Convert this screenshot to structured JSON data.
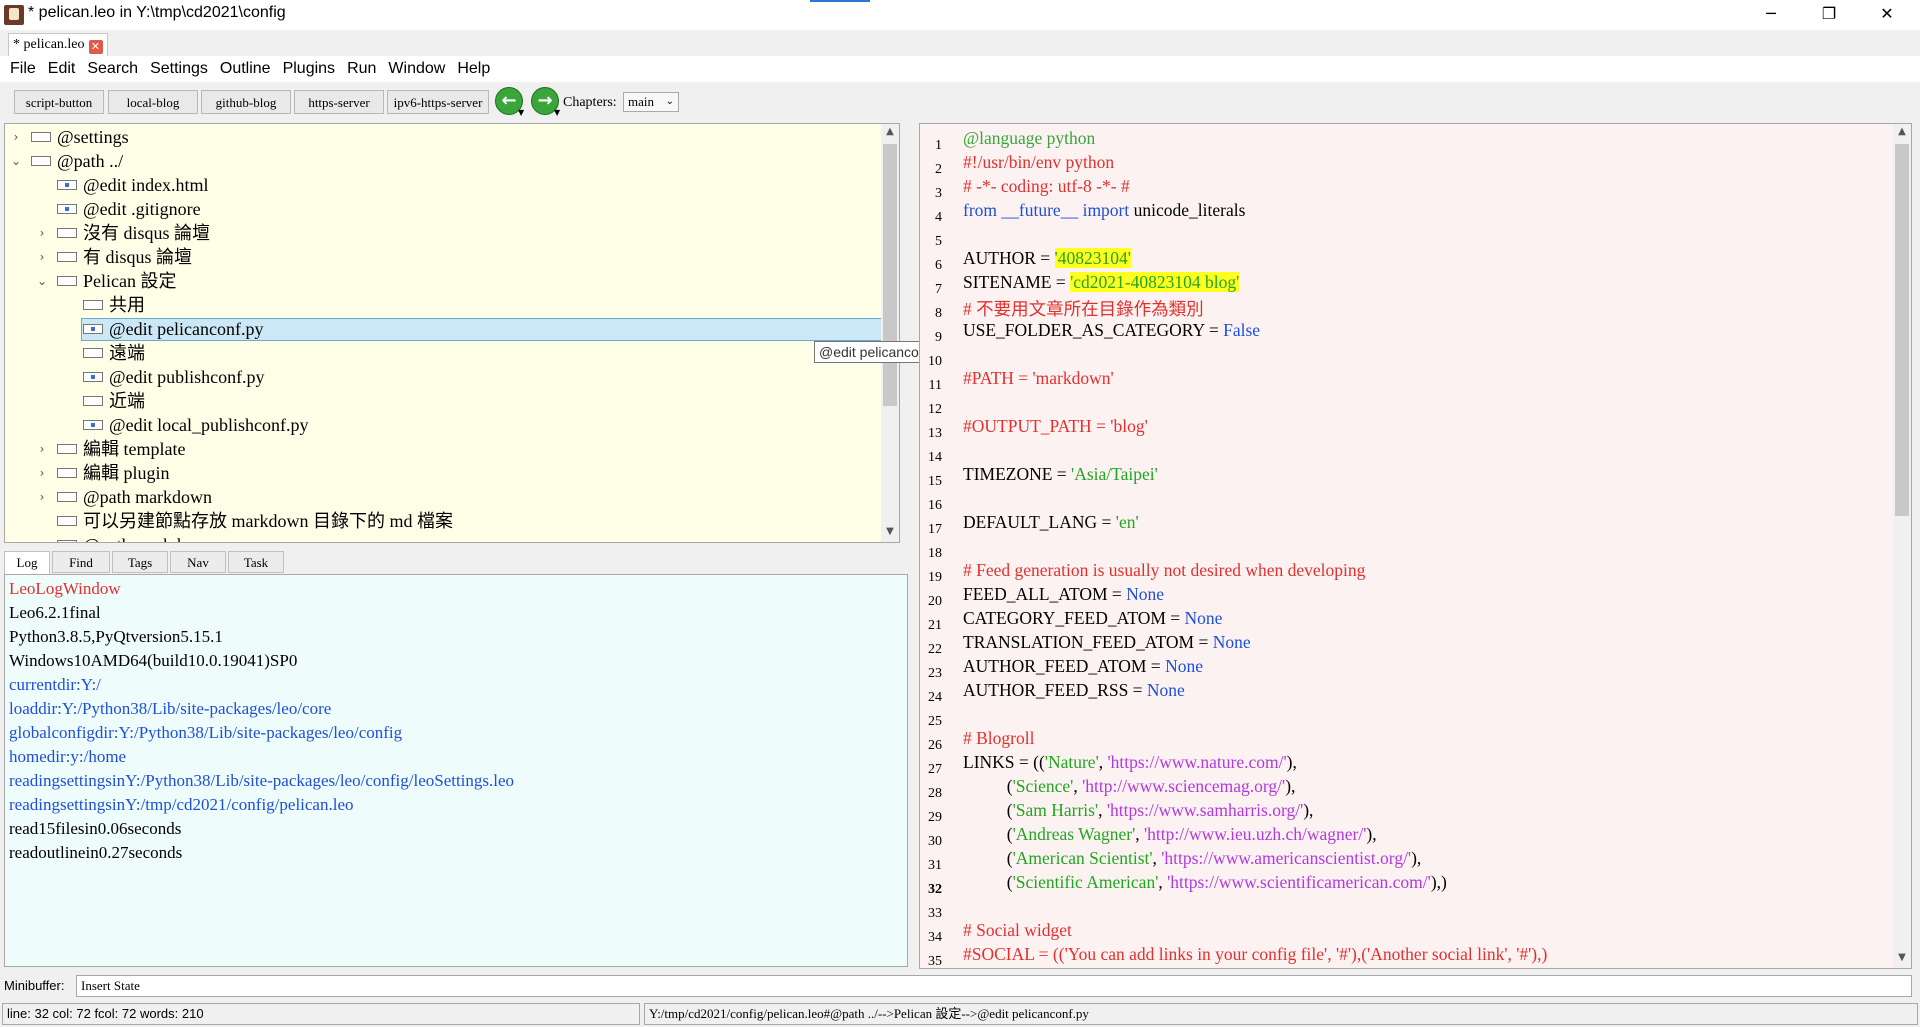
{
  "window": {
    "title": "* pelican.leo in Y:\\tmp\\cd2021\\config",
    "minimize": "─",
    "restore": "❐",
    "close": "✕"
  },
  "doc_tab": {
    "label": "* pelican.leo",
    "close": "✕"
  },
  "menu": [
    "File",
    "Edit",
    "Search",
    "Settings",
    "Outline",
    "Plugins",
    "Run",
    "Window",
    "Help"
  ],
  "toolbar": {
    "buttons": [
      "script-button",
      "local-blog",
      "github-blog",
      "https-server",
      "ipv6-https-server"
    ],
    "back_arrow": "←",
    "forward_arrow": "→",
    "chapters_label": "Chapters:",
    "chapters_value": "main"
  },
  "outline": {
    "nodes": [
      {
        "label": "@settings",
        "caret": "›"
      },
      {
        "label": "@path ../",
        "caret": "⌄"
      },
      {
        "label": "@edit index.html",
        "caret": ""
      },
      {
        "label": "@edit .gitignore",
        "caret": ""
      },
      {
        "label": "沒有 disqus 論壇",
        "caret": "›"
      },
      {
        "label": "有 disqus 論壇",
        "caret": "›"
      },
      {
        "label": "Pelican 設定",
        "caret": "⌄"
      },
      {
        "label": "共用",
        "caret": ""
      },
      {
        "label": "@edit pelicanconf.py",
        "caret": ""
      },
      {
        "label": "遠端",
        "caret": ""
      },
      {
        "label": "@edit publishconf.py",
        "caret": ""
      },
      {
        "label": "近端",
        "caret": ""
      },
      {
        "label": "@edit local_publishconf.py",
        "caret": ""
      },
      {
        "label": "編輯 template",
        "caret": "›"
      },
      {
        "label": "編輯 plugin",
        "caret": "›"
      },
      {
        "label": "@path markdown",
        "caret": "›"
      },
      {
        "label": "可以另建節點存放 markdown 目錄下的 md 檔案",
        "caret": ""
      },
      {
        "label": "@path markdown",
        "caret": "⌄"
      }
    ],
    "tooltip": "@edit pelicanconf.py"
  },
  "log_tabs": [
    "Log",
    "Find",
    "Tags",
    "Nav",
    "Task"
  ],
  "log": {
    "lines": [
      "LeoLogWindow",
      "Leo6.2.1final",
      "Python3.8.5,PyQtversion5.15.1",
      "Windows10AMD64(build10.0.19041)SP0",
      "currentdir:Y:/",
      "loaddir:Y:/Python38/Lib/site-packages/leo/core",
      "globalconfigdir:Y:/Python38/Lib/site-packages/leo/config",
      "homedir:y:/home",
      "readingsettingsinY:/Python38/Lib/site-packages/leo/config/leoSettings.leo",
      "readingsettingsinY:/tmp/cd2021/config/pelican.leo",
      "read15filesin0.06seconds",
      "readoutlinein0.27seconds"
    ],
    "colors": [
      "#e0312f",
      "#000000",
      "#000000",
      "#000000",
      "#1f4fd6",
      "#1f4fd6",
      "#1f4fd6",
      "#1f4fd6",
      "#1f4fd6",
      "#1f4fd6",
      "#000000",
      "#000000"
    ]
  },
  "editor": {
    "line_numbers": [
      "1",
      "2",
      "3",
      "4",
      "5",
      "6",
      "7",
      "8",
      "9",
      "10",
      "11",
      "12",
      "13",
      "14",
      "15",
      "16",
      "17",
      "18",
      "19",
      "20",
      "21",
      "22",
      "23",
      "24",
      "25",
      "26",
      "27",
      "28",
      "29",
      "30",
      "31",
      "32",
      "33",
      "34",
      "35"
    ],
    "code": {
      "l1": "@language python",
      "l2": "#!/usr/bin/env python",
      "l3": "# -*- coding: utf-8 -*- #",
      "l4_from": "from",
      "l4_future": "__future__",
      "l4_import": "import",
      "l4_rest": "unicode_literals",
      "l6_key": "AUTHOR = ",
      "l6_val": "'40823104'",
      "l7_key": "SITENAME = ",
      "l7_val": "'cd2021-40823104 blog'",
      "l8": "# 不要用文章所在目錄作為類別",
      "l9_key": "USE_FOLDER_AS_CATEGORY = ",
      "l9_val": "False",
      "l11": "#PATH = 'markdown'",
      "l13": "#OUTPUT_PATH = 'blog'",
      "l15_key": "TIMEZONE = ",
      "l15_val": "'Asia/Taipei'",
      "l17_key": "DEFAULT_LANG = ",
      "l17_val": "'en'",
      "l19": "# Feed generation is usually not desired when developing",
      "l20_key": "FEED_ALL_ATOM = ",
      "l21_key": "CATEGORY_FEED_ATOM = ",
      "l22_key": "TRANSLATION_FEED_ATOM = ",
      "l23_key": "AUTHOR_FEED_ATOM = ",
      "l24_key": "AUTHOR_FEED_RSS = ",
      "none": "None",
      "l26": "# Blogroll",
      "l27_pre": "LINKS = ((",
      "l27_name": "'Nature'",
      "l27_url": "'https://www.nature.com/'",
      "l28_name": "'Science'",
      "l28_url": "'http://www.sciencemag.org/'",
      "l29_name": "'Sam Harris'",
      "l29_url": "'https://www.samharris.org/'",
      "l30_name": "'Andreas Wagner'",
      "l30_url": "'http://www.ieu.uzh.ch/wagner/'",
      "l31_name": "'American Scientist'",
      "l31_url": "'https://www.americanscientist.org/'",
      "l32_name": "'Scientific American'",
      "l32_url": "'https://www.scientificamerican.com/'",
      "l34": "# Social widget",
      "l35": "#SOCIAL = (('You can add links in your config file', '#'),('Another social link', '#'),)"
    }
  },
  "minibuffer": {
    "label": "Minibuffer:",
    "value": "Insert State"
  },
  "status": {
    "left": "line: 32 col: 72  fcol: 72 words: 210",
    "right": "Y:/tmp/cd2021/config/pelican.leo#@path ../-->Pelican 設定-->@edit pelicanconf.py"
  }
}
